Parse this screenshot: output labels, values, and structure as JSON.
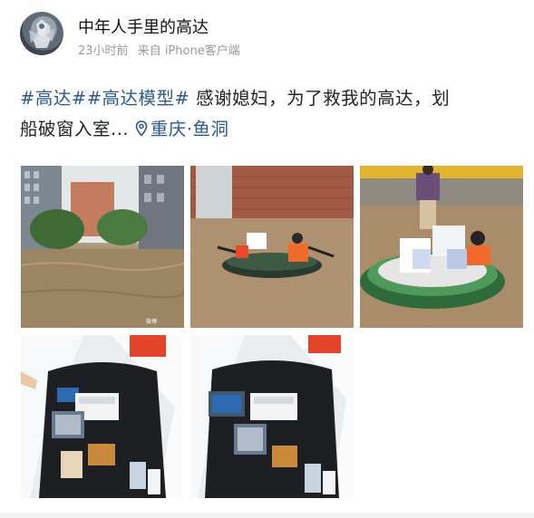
{
  "post": {
    "author": "中年人手里的高达",
    "time": "23小时前",
    "source": "来自 iPhone客户端",
    "topics": [
      "#高达#",
      "#高达模型#"
    ],
    "text_line1": " 感谢媳妇，为了救我的高达，划",
    "text_line2": "船破窗入室...",
    "location": "重庆·鱼洞"
  },
  "photos": [
    {
      "name": "flooded-street-photo",
      "icon": "photo-icon"
    },
    {
      "name": "rowing-boat-photo",
      "icon": "photo-icon"
    },
    {
      "name": "boat-with-boxes-photo",
      "icon": "photo-icon"
    },
    {
      "name": "bag-with-gundam-boxes-photo-1",
      "icon": "photo-icon"
    },
    {
      "name": "bag-with-gundam-boxes-photo-2",
      "icon": "photo-icon"
    }
  ],
  "colors": {
    "link": "#2e5a8a",
    "meta": "#9a9a9a",
    "text": "#222222"
  }
}
